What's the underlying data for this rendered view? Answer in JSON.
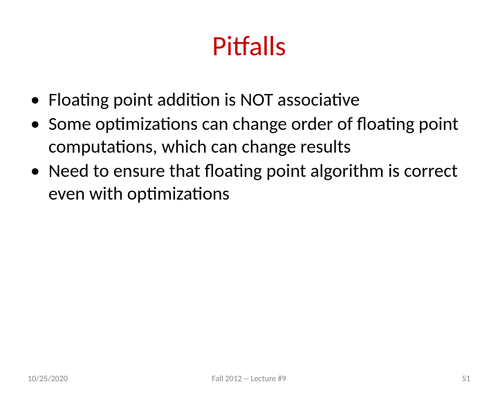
{
  "title": "Pitfalls",
  "bullets": [
    "Floating point addition is NOT associative",
    "Some optimizations can change order of floating point computations, which can change results",
    "Need to ensure that floating point algorithm is correct even with optimizations"
  ],
  "footer": {
    "date": "10/25/2020",
    "center": "Fall 2012 -- Lecture #9",
    "page": "51"
  }
}
